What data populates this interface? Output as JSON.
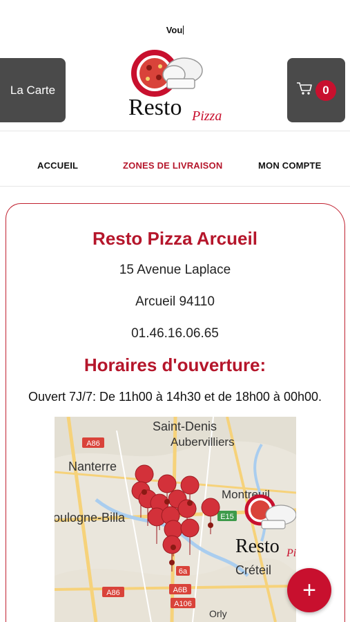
{
  "header": {
    "status_text": "Vou",
    "carte_button": "La Carte",
    "cart_count": "0",
    "cart_icon": "cart-icon",
    "logo": {
      "word1": "Resto",
      "word2": "Pizza"
    }
  },
  "nav": {
    "items": [
      {
        "label": "ACCUEIL"
      },
      {
        "label": "ZONES DE LIVRAISON",
        "active": true
      },
      {
        "label": "MON COMPTE"
      }
    ]
  },
  "restaurant": {
    "name": "Resto Pizza Arcueil",
    "address": "15 Avenue Laplace",
    "city": "Arcueil 94110",
    "phone": "01.46.16.06.65",
    "hours_title": "Horaires d'ouverture:",
    "hours": "Ouvert 7J/7: De 11h00 à 14h30 et de 18h00 à 00h00."
  },
  "map": {
    "places": [
      "Saint-Denis",
      "Aubervilliers",
      "Nanterre",
      "Montreuil",
      "oulogne-Billa",
      "Créteil",
      "Orly"
    ],
    "roads": [
      "A86",
      "A86",
      "E15",
      "A6B",
      "A106",
      "6a"
    ],
    "logo_word1": "Resto",
    "logo_word2": "Pizza"
  },
  "fab": {
    "label": "+"
  },
  "colors": {
    "accent": "#c8102e",
    "button_dark": "#4a4a4a",
    "nav_active": "#b5162b"
  }
}
